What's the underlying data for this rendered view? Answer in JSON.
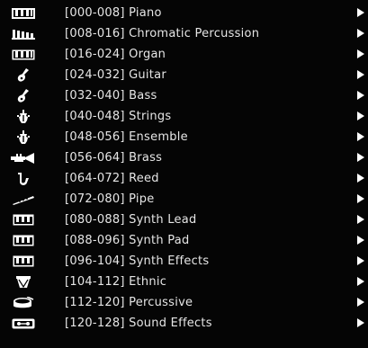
{
  "menu": {
    "items": [
      {
        "label": "[000-008] Piano",
        "icon": "piano-icon"
      },
      {
        "label": "[008-016] Chromatic Percussion",
        "icon": "xylophone-icon"
      },
      {
        "label": "[016-024] Organ",
        "icon": "organ-icon"
      },
      {
        "label": "[024-032] Guitar",
        "icon": "guitar-icon"
      },
      {
        "label": "[032-040] Bass",
        "icon": "bass-icon"
      },
      {
        "label": "[040-048] Strings",
        "icon": "violin-icon"
      },
      {
        "label": "[048-056] Ensemble",
        "icon": "ensemble-icon"
      },
      {
        "label": "[056-064] Brass",
        "icon": "trumpet-icon"
      },
      {
        "label": "[064-072] Reed",
        "icon": "saxophone-icon"
      },
      {
        "label": "[072-080] Pipe",
        "icon": "flute-icon"
      },
      {
        "label": "[080-088] Synth Lead",
        "icon": "synth-lead-icon"
      },
      {
        "label": "[088-096] Synth Pad",
        "icon": "synth-pad-icon"
      },
      {
        "label": "[096-104] Synth Effects",
        "icon": "synth-effects-icon"
      },
      {
        "label": "[104-112] Ethnic",
        "icon": "ethnic-drum-icon"
      },
      {
        "label": "[112-120] Percussive",
        "icon": "drum-icon"
      },
      {
        "label": "[120-128] Sound Effects",
        "icon": "sound-effects-icon"
      }
    ]
  },
  "colors": {
    "background": "#050505",
    "text": "#e6e6e6",
    "arrow": "#ffffff"
  }
}
